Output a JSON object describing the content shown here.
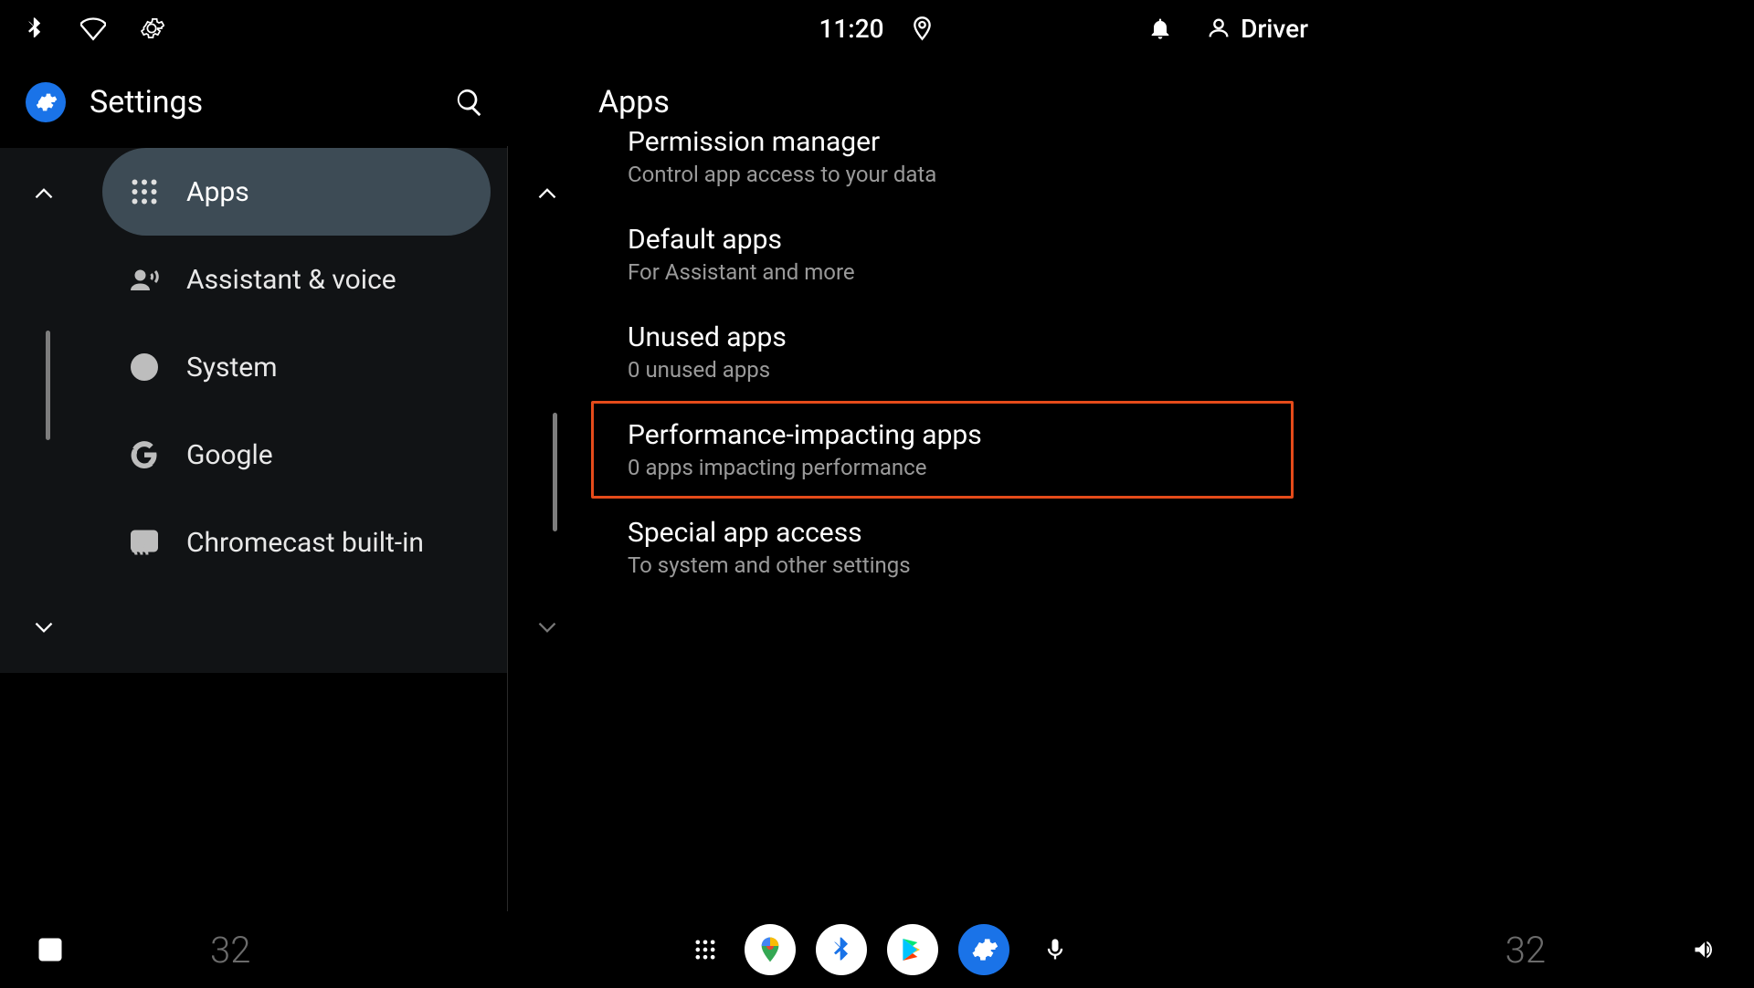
{
  "status": {
    "time": "11:20",
    "user": "Driver"
  },
  "left": {
    "title": "Settings",
    "nav": [
      {
        "icon": "apps",
        "label": "Apps",
        "selected": true
      },
      {
        "icon": "assistant",
        "label": "Assistant & voice",
        "selected": false
      },
      {
        "icon": "info",
        "label": "System",
        "selected": false
      },
      {
        "icon": "google-g",
        "label": "Google",
        "selected": false
      },
      {
        "icon": "cast",
        "label": "Chromecast built-in",
        "selected": false
      }
    ]
  },
  "right": {
    "title": "Apps",
    "items": [
      {
        "title": "Permission manager",
        "sub": "Control app access to your data",
        "highlight": false,
        "clipped": true
      },
      {
        "title": "Default apps",
        "sub": "For Assistant and more",
        "highlight": false,
        "clipped": false
      },
      {
        "title": "Unused apps",
        "sub": "0 unused apps",
        "highlight": false,
        "clipped": false
      },
      {
        "title": "Performance-impacting apps",
        "sub": "0 apps impacting performance",
        "highlight": true,
        "clipped": false
      },
      {
        "title": "Special app access",
        "sub": "To system and other settings",
        "highlight": false,
        "clipped": false
      }
    ]
  },
  "bottom": {
    "temp_left": "32",
    "temp_right": "32"
  }
}
